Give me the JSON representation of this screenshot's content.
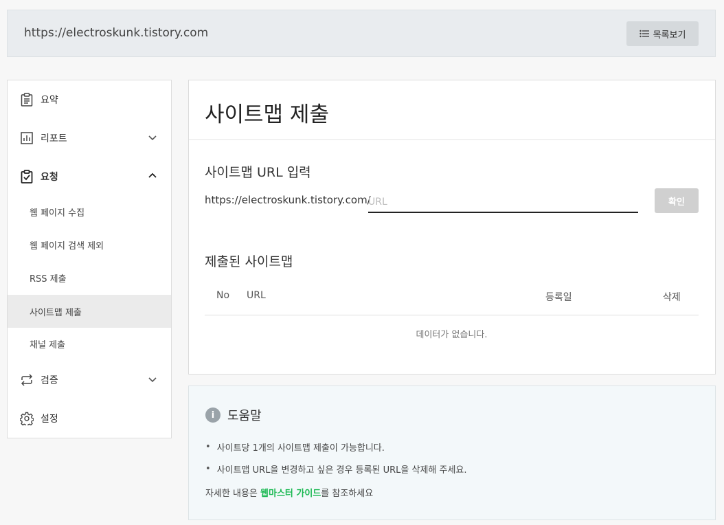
{
  "header": {
    "site_url": "https://electroskunk.tistory.com",
    "list_button": "목록보기"
  },
  "sidebar": {
    "items": [
      {
        "label": "요약",
        "icon": "clipboard-icon"
      },
      {
        "label": "리포트",
        "icon": "bar-chart-icon",
        "expanded": false
      },
      {
        "label": "요청",
        "icon": "clipboard-check-icon",
        "expanded": true
      },
      {
        "label": "검증",
        "icon": "repeat-icon",
        "expanded": false
      },
      {
        "label": "설정",
        "icon": "gear-icon"
      }
    ],
    "subitems": [
      {
        "label": "웹 페이지 수집"
      },
      {
        "label": "웹 페이지 검색 제외"
      },
      {
        "label": "RSS 제출"
      },
      {
        "label": "사이트맵 제출",
        "active": true
      },
      {
        "label": "채널 제출"
      }
    ]
  },
  "main": {
    "title": "사이트맵 제출",
    "input_section_label": "사이트맵 URL 입력",
    "url_prefix": "https://electroskunk.tistory.com/",
    "url_value": "",
    "url_placeholder": "URL",
    "confirm_label": "확인",
    "submitted_label": "제출된 사이트맵",
    "table_headers": {
      "no": "No",
      "url": "URL",
      "date": "등록일",
      "delete": "삭제"
    },
    "empty_text": "데이터가 없습니다."
  },
  "help": {
    "title": "도움말",
    "bullets": [
      "사이트당 1개의 사이트맵 제출이 가능합니다.",
      "사이트맵 URL을 변경하고 싶은 경우 등록된 URL을 삭제해 주세요."
    ],
    "footer_prefix": "자세한 내용은 ",
    "footer_link": "웹마스터 가이드",
    "footer_suffix": "를 참조하세요"
  },
  "colors": {
    "link": "#1db954",
    "active_bg": "#ebebeb",
    "button_disabled": "#d0d0d0"
  }
}
